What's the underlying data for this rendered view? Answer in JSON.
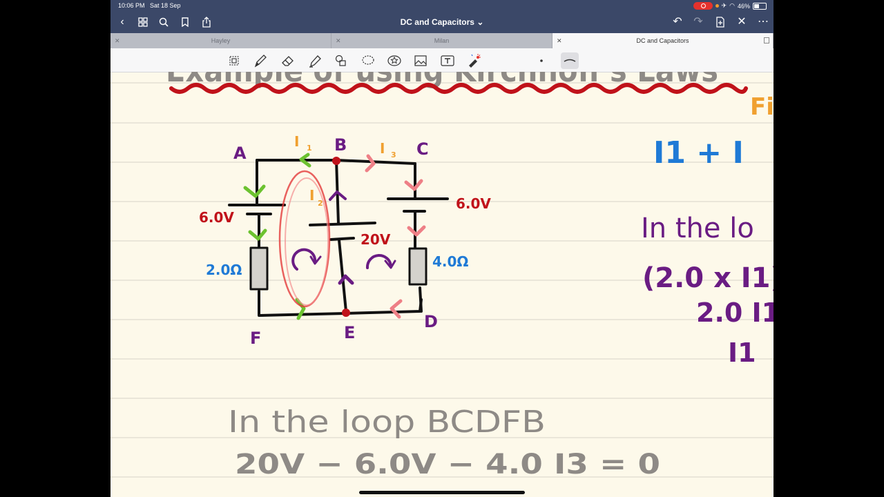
{
  "status": {
    "time": "10:06 PM",
    "date": "Sat 18 Sep",
    "battery": "46%"
  },
  "nav": {
    "title": "DC and Capacitors ⌄"
  },
  "tabs": [
    {
      "label": "Hayley",
      "active": false
    },
    {
      "label": "Milan",
      "active": false
    },
    {
      "label": "DC and Capacitors",
      "active": true
    }
  ],
  "tools": [
    "lasso-image-tool",
    "pen-tool",
    "eraser-tool",
    "highlighter-tool",
    "shapes-tool",
    "lasso-tool",
    "sticker-tool",
    "image-tool",
    "text-tool",
    "laser-pointer-tool",
    "pen-size-small",
    "pen-size-medium"
  ],
  "colors": {
    "bar": "#3b4868",
    "paper": "#fdf9ea",
    "red": "#c0121a",
    "green": "#6cc230",
    "orange": "#f0a030",
    "pink": "#ee7f86",
    "purple": "#6a1c83",
    "blue": "#1f7ad6",
    "grey": "#8e8a86"
  },
  "note": {
    "heading": "Example of using Kirchhoff's Laws",
    "circuit": {
      "nodes": [
        "A",
        "B",
        "C",
        "D",
        "E",
        "F"
      ],
      "currents": [
        "I1",
        "I2",
        "I3"
      ],
      "labels": {
        "emf_left": "6.0V",
        "emf_mid": "20V",
        "emf_right": "6.0V",
        "res_left": "2.0Ω",
        "res_right": "4.0Ω"
      }
    },
    "right_column": {
      "first_law_tag": "Fi",
      "equation": "I1 + I",
      "loop_text": "In the lo",
      "step1": "(2.0 x I1)",
      "step2": "2.0 I1",
      "step3": "I1"
    },
    "bottom": {
      "loop_title": "In the loop BCDFB",
      "equation": "20V − 6.0V − 4.0 I3 = 0"
    }
  }
}
